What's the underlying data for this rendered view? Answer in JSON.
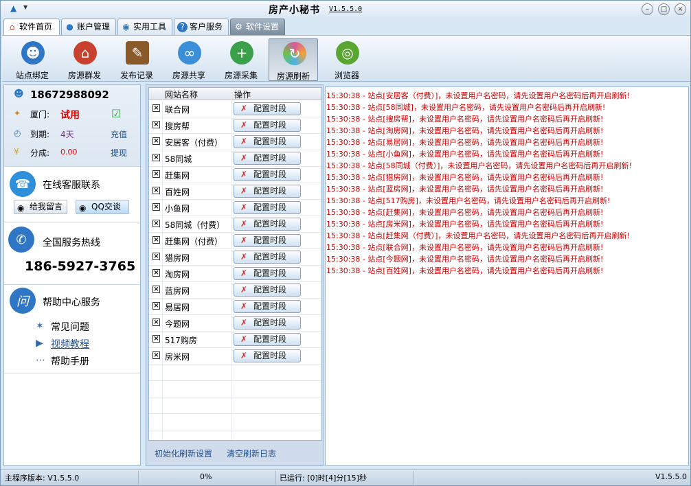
{
  "window": {
    "title": "房产小秘书",
    "version": "V1.5.5.0"
  },
  "tabs": [
    {
      "label": "软件首页",
      "icon": "home-icon"
    },
    {
      "label": "账户管理",
      "icon": "user-icon"
    },
    {
      "label": "实用工具",
      "icon": "tools-icon"
    },
    {
      "label": "客户服务",
      "icon": "help-icon"
    },
    {
      "label": "软件设置",
      "icon": "gear-icon"
    }
  ],
  "toolbar": [
    {
      "label": "站点绑定",
      "icon": "user-add-icon",
      "color": "#2f77c4"
    },
    {
      "label": "房源群发",
      "icon": "house-icon",
      "color": "#c8412e"
    },
    {
      "label": "发布记录",
      "icon": "notebook-icon",
      "color": "#8a5a2b"
    },
    {
      "label": "房源共享",
      "icon": "paperclip-icon",
      "color": "#3b8fd8"
    },
    {
      "label": "房源采集",
      "icon": "magnifier-icon",
      "color": "#3aa04a"
    },
    {
      "label": "房源刷新",
      "icon": "refresh-icon",
      "color": "#d55a9e"
    },
    {
      "label": "浏览器",
      "icon": "browser-icon",
      "color": "#5aa632"
    }
  ],
  "account": {
    "phone": "18672988092",
    "city_label": "厦门:",
    "city_value": "试用",
    "expire_label": "到期:",
    "expire_value": "4天",
    "recharge": "充值",
    "share_label": "分成:",
    "share_value": "0.00",
    "withdraw": "提现"
  },
  "service": {
    "online_title": "在线客服联系",
    "leave_msg": "给我留言",
    "qq_chat": "QQ交谈",
    "hotline_title": "全国服务热线",
    "hotline": "186-5927-3765",
    "help_title": "帮助中心服务",
    "help_items": [
      "常见问题",
      "视频教程",
      "帮助手册"
    ]
  },
  "grid": {
    "col_site": "网站名称",
    "col_op": "操作",
    "button_label": "配置时段",
    "rows": [
      "联合网",
      "搜房帮",
      "安居客（付费）",
      "58同城",
      "赶集网",
      "百姓网",
      "小鱼网",
      "58同城（付费）",
      "赶集网（付费）",
      "猎房网",
      "淘房网",
      "蓝房网",
      "易居网",
      "今题网",
      "517购房",
      "房米网"
    ],
    "init_link": "初始化刷新设置",
    "clear_link": "清空刷新日志"
  },
  "log": [
    "15:30:38 - 站点[安居客（付费）]，未设置用户名密码，请先设置用户名密码后再开启刷新!",
    "15:30:38 - 站点[58同城]，未设置用户名密码，请先设置用户名密码后再开启刷新!",
    "15:30:38 - 站点[搜房帮]，未设置用户名密码，请先设置用户名密码后再开启刷新!",
    "15:30:38 - 站点[淘房网]，未设置用户名密码，请先设置用户名密码后再开启刷新!",
    "15:30:38 - 站点[易居网]，未设置用户名密码，请先设置用户名密码后再开启刷新!",
    "15:30:38 - 站点[小鱼网]，未设置用户名密码，请先设置用户名密码后再开启刷新!",
    "15:30:38 - 站点[58同城（付费）]，未设置用户名密码，请先设置用户名密码后再开启刷新!",
    "15:30:38 - 站点[猎房网]，未设置用户名密码，请先设置用户名密码后再开启刷新!",
    "15:30:38 - 站点[蓝房网]，未设置用户名密码，请先设置用户名密码后再开启刷新!",
    "15:30:38 - 站点[517购房]，未设置用户名密码，请先设置用户名密码后再开启刷新!",
    "15:30:38 - 站点[赶集网]，未设置用户名密码，请先设置用户名密码后再开启刷新!",
    "15:30:38 - 站点[房米网]，未设置用户名密码，请先设置用户名密码后再开启刷新!",
    "15:30:38 - 站点[赶集网（付费）]，未设置用户名密码，请先设置用户名密码后再开启刷新!",
    "15:30:38 - 站点[联合网]，未设置用户名密码，请先设置用户名密码后再开启刷新!",
    "15:30:38 - 站点[今题网]，未设置用户名密码，请先设置用户名密码后再开启刷新!",
    "15:30:38 - 站点[百姓网]，未设置用户名密码，请先设置用户名密码后再开启刷新!"
  ],
  "status": {
    "main_version": "主程序版本: V1.5.5.0",
    "progress": "0%",
    "runtime": "已运行: [0]时[4]分[15]秒",
    "version": "V1.5.5.0"
  }
}
